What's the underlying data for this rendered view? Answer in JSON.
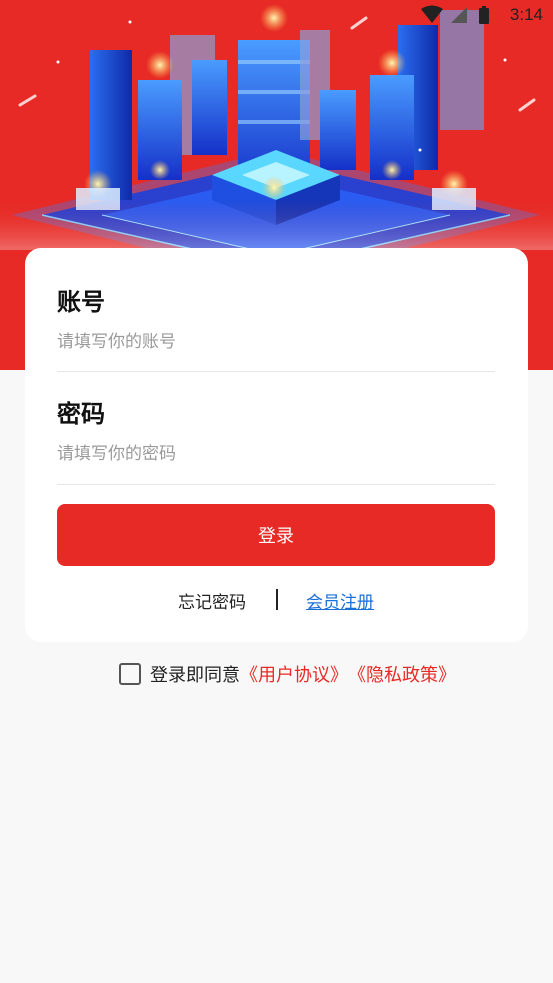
{
  "status_bar": {
    "time": "3:14"
  },
  "login": {
    "account_label": "账号",
    "account_placeholder": "请填写你的账号",
    "password_label": "密码",
    "password_placeholder": "请填写你的密码",
    "login_button": "登录",
    "forgot_password": "忘记密码",
    "register": "会员注册"
  },
  "agreement": {
    "prefix": "登录即同意",
    "user_agreement": "《用户协议》",
    "privacy_policy": "《隐私政策》",
    "checked": false
  },
  "colors": {
    "brand_red": "#e72a25",
    "link_blue": "#1a6fd6",
    "background": "#f8f8f8"
  }
}
